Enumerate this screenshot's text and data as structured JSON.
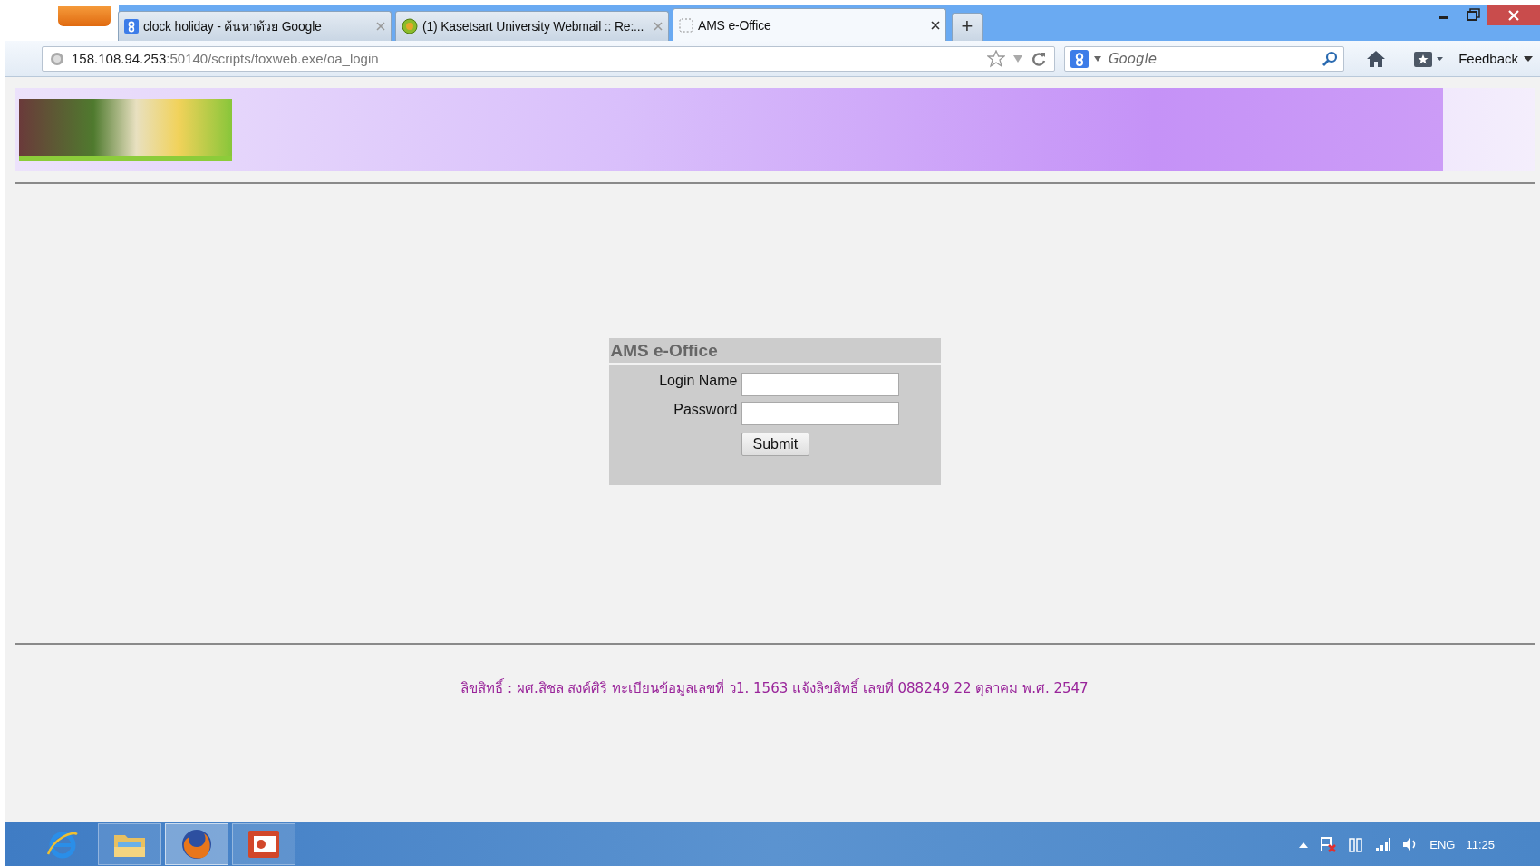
{
  "browser": {
    "tabs": [
      {
        "title": "clock holiday - ค้นหาด้วย Google",
        "kind": "google",
        "selected": false
      },
      {
        "title": "(1) Kasetsart University Webmail :: Re:...",
        "kind": "webmail",
        "selected": false
      },
      {
        "title": "AMS e-Office",
        "kind": "blank",
        "selected": true
      }
    ],
    "new_tab": "+",
    "url_host": "158.108.94.253",
    "url_path": ":50140/scripts/foxweb.exe/oa_login",
    "search": {
      "placeholder": "Google"
    },
    "feedback": "Feedback"
  },
  "page": {
    "login": {
      "title": "AMS e-Office",
      "fields": [
        {
          "label": "Login Name"
        },
        {
          "label": "Password"
        }
      ],
      "submit": "Submit"
    },
    "footer": "ลิขสิทธิ์ : ผศ.สิชล สงค์ศิริ ทะเบียนข้อมูลเลขที่ ว1. 1563 แจ้งลิขสิทธิ์ เลขที่ 088249 22 ตุลาคม พ.ศ. 2547"
  },
  "taskbar": {
    "apps": [
      {
        "kind": "ie",
        "selected": false
      },
      {
        "kind": "folder",
        "selected": false
      },
      {
        "kind": "firefox",
        "selected": true
      },
      {
        "kind": "slides",
        "selected": false
      }
    ],
    "language": "ENG",
    "clock": "11:25"
  }
}
